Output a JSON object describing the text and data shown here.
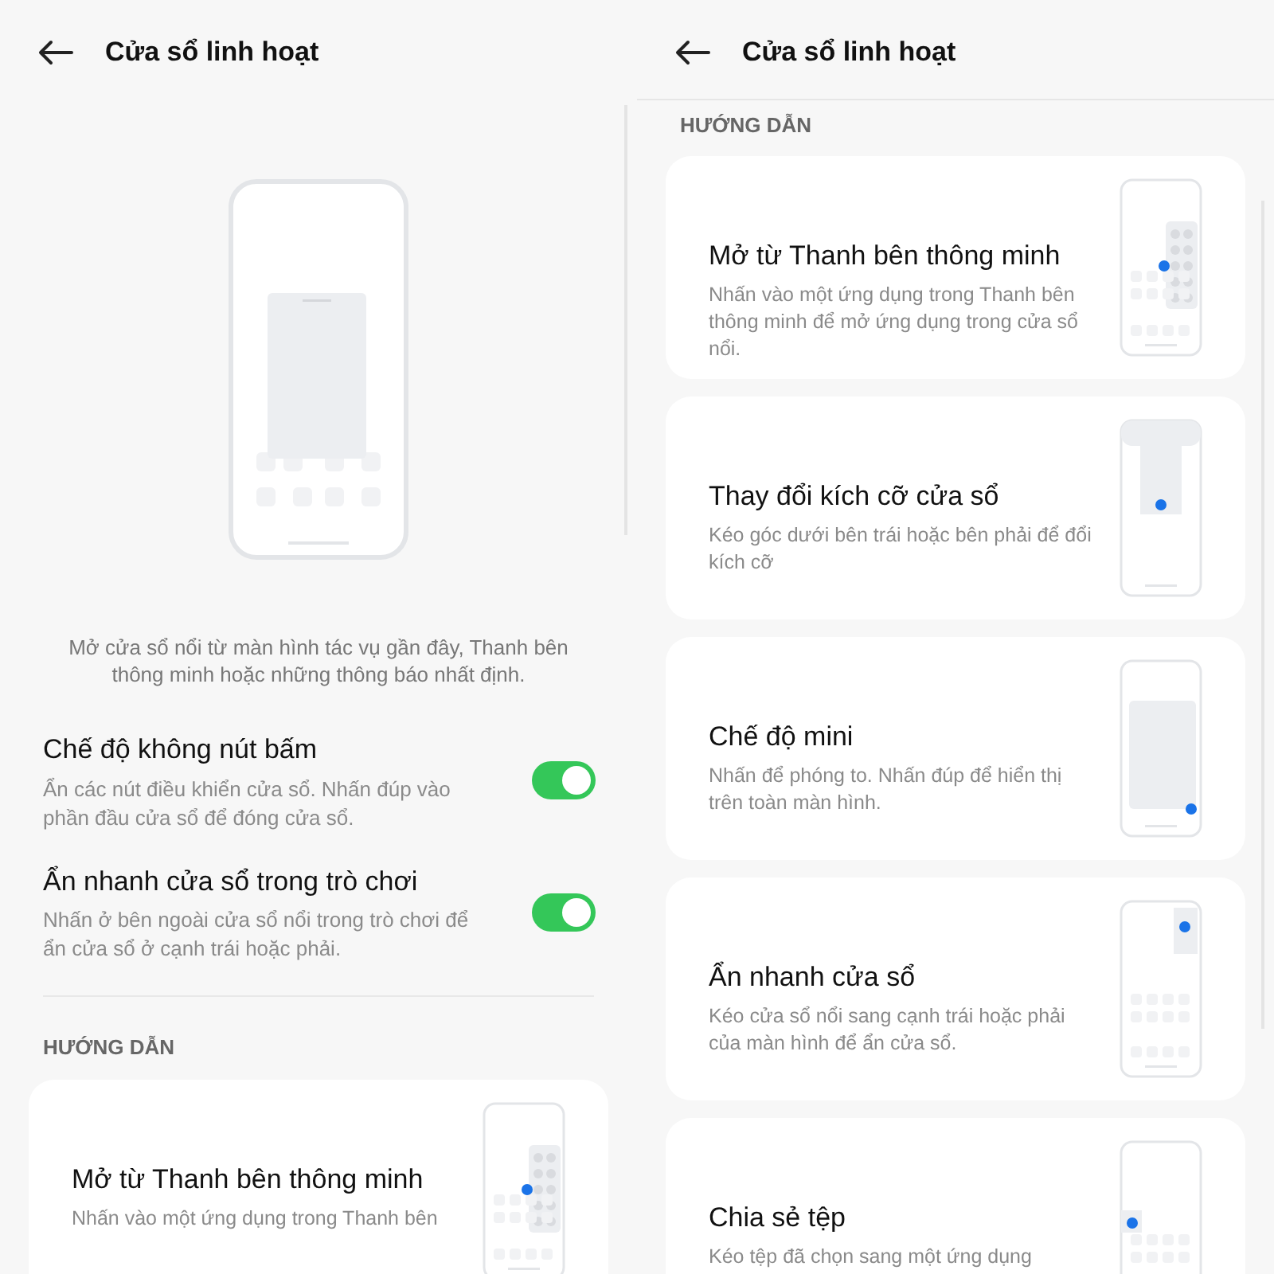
{
  "panels": [
    {
      "title": "Cửa sổ linh hoạt",
      "illustration": {
        "kind": "picture"
      },
      "caption": "Mở cửa sổ nổi từ màn hình tác vụ gần đây, Thanh bên thông minh hoặc những thông báo nhất định.",
      "toggles": [
        {
          "title": "Chế độ không nút bấm",
          "description": "Ẩn các nút điều khiển cửa sổ. Nhấn đúp vào phần đầu cửa sổ để đóng cửa sổ.",
          "on": true
        },
        {
          "title": "Ẩn nhanh cửa sổ trong trò chơi",
          "description": "Nhấn ở bên ngoài cửa sổ nổi trong trò chơi để ẩn cửa sổ ở cạnh trái hoặc phải.",
          "on": true
        }
      ],
      "section_header": "HƯỚNG DẪN",
      "guides": [
        {
          "kind": "sidebar",
          "title": "Mở từ Thanh bên thông minh",
          "description": "Nhấn vào một ứng dụng trong Thanh bên"
        }
      ]
    },
    {
      "title": "Cửa sổ linh hoạt",
      "section_header": "HƯỚNG DẪN",
      "guides": [
        {
          "kind": "sidebar",
          "title": "Mở từ Thanh bên thông minh",
          "description": "Nhấn vào một ứng dụng trong Thanh bên thông minh để mở ứng dụng trong cửa sổ nổi."
        },
        {
          "kind": "resize",
          "title": "Thay đổi kích cỡ cửa sổ",
          "description": "Kéo góc dưới bên trái hoặc bên phải để đổi kích cỡ"
        },
        {
          "kind": "mini",
          "title": "Chế độ mini",
          "description": "Nhấn để phóng to. Nhấn đúp để hiển thị trên toàn màn hình."
        },
        {
          "kind": "hide",
          "title": "Ẩn nhanh cửa sổ",
          "description": "Kéo cửa sổ nổi sang cạnh trái hoặc phải của màn hình để ẩn cửa sổ."
        },
        {
          "kind": "share",
          "title": "Chia sẻ tệp",
          "description": "Kéo tệp đã chọn sang một ứng dụng"
        }
      ]
    }
  ]
}
